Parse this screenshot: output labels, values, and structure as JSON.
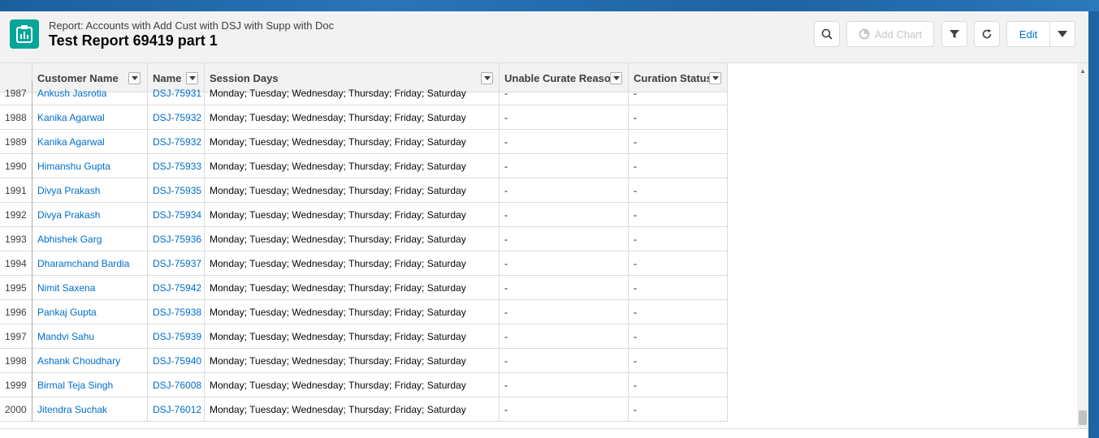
{
  "header": {
    "subtitle": "Report: Accounts with Add Cust with DSJ with Supp with Doc",
    "title": "Test Report 69419 part 1",
    "add_chart_label": "Add Chart",
    "edit_label": "Edit"
  },
  "columns": [
    {
      "label": "Customer Name"
    },
    {
      "label": "Name"
    },
    {
      "label": "Session Days"
    },
    {
      "label": "Unable Curate Reason"
    },
    {
      "label": "Curation Status"
    }
  ],
  "rows": [
    {
      "num": "1987",
      "customer": "Ankush Jasrotia",
      "name": "DSJ-75931",
      "days": "Monday; Tuesday; Wednesday; Thursday; Friday; Saturday",
      "reason": "-",
      "status": "-"
    },
    {
      "num": "1988",
      "customer": "Kanika Agarwal",
      "name": "DSJ-75932",
      "days": "Monday; Tuesday; Wednesday; Thursday; Friday; Saturday",
      "reason": "-",
      "status": "-"
    },
    {
      "num": "1989",
      "customer": "Kanika Agarwal",
      "name": "DSJ-75932",
      "days": "Monday; Tuesday; Wednesday; Thursday; Friday; Saturday",
      "reason": "-",
      "status": "-"
    },
    {
      "num": "1990",
      "customer": "Himanshu Gupta",
      "name": "DSJ-75933",
      "days": "Monday; Tuesday; Wednesday; Thursday; Friday; Saturday",
      "reason": "-",
      "status": "-"
    },
    {
      "num": "1991",
      "customer": "Divya Prakash",
      "name": "DSJ-75935",
      "days": "Monday; Tuesday; Wednesday; Thursday; Friday; Saturday",
      "reason": "-",
      "status": "-"
    },
    {
      "num": "1992",
      "customer": "Divya Prakash",
      "name": "DSJ-75934",
      "days": "Monday; Tuesday; Wednesday; Thursday; Friday; Saturday",
      "reason": "-",
      "status": "-"
    },
    {
      "num": "1993",
      "customer": "Abhishek Garg",
      "name": "DSJ-75936",
      "days": "Monday; Tuesday; Wednesday; Thursday; Friday; Saturday",
      "reason": "-",
      "status": "-"
    },
    {
      "num": "1994",
      "customer": "Dharamchand Bardia",
      "name": "DSJ-75937",
      "days": "Monday; Tuesday; Wednesday; Thursday; Friday; Saturday",
      "reason": "-",
      "status": "-"
    },
    {
      "num": "1995",
      "customer": "Nimit Saxena",
      "name": "DSJ-75942",
      "days": "Monday; Tuesday; Wednesday; Thursday; Friday; Saturday",
      "reason": "-",
      "status": "-"
    },
    {
      "num": "1996",
      "customer": "Pankaj Gupta",
      "name": "DSJ-75938",
      "days": "Monday; Tuesday; Wednesday; Thursday; Friday; Saturday",
      "reason": "-",
      "status": "-"
    },
    {
      "num": "1997",
      "customer": "Mandvi Sahu",
      "name": "DSJ-75939",
      "days": "Monday; Tuesday; Wednesday; Thursday; Friday; Saturday",
      "reason": "-",
      "status": "-"
    },
    {
      "num": "1998",
      "customer": "Ashank Choudhary",
      "name": "DSJ-75940",
      "days": "Monday; Tuesday; Wednesday; Thursday; Friday; Saturday",
      "reason": "-",
      "status": "-"
    },
    {
      "num": "1999",
      "customer": "Birmal Teja Singh",
      "name": "DSJ-76008",
      "days": "Monday; Tuesday; Wednesday; Thursday; Friday; Saturday",
      "reason": "-",
      "status": "-"
    },
    {
      "num": "2000",
      "customer": "Jitendra Suchak",
      "name": "DSJ-76012",
      "days": "Monday; Tuesday; Wednesday; Thursday; Friday; Saturday",
      "reason": "-",
      "status": "-"
    }
  ],
  "colors": {
    "accent": "#0070d2",
    "link": "#006dcc",
    "icon_bg": "#06a59a"
  }
}
